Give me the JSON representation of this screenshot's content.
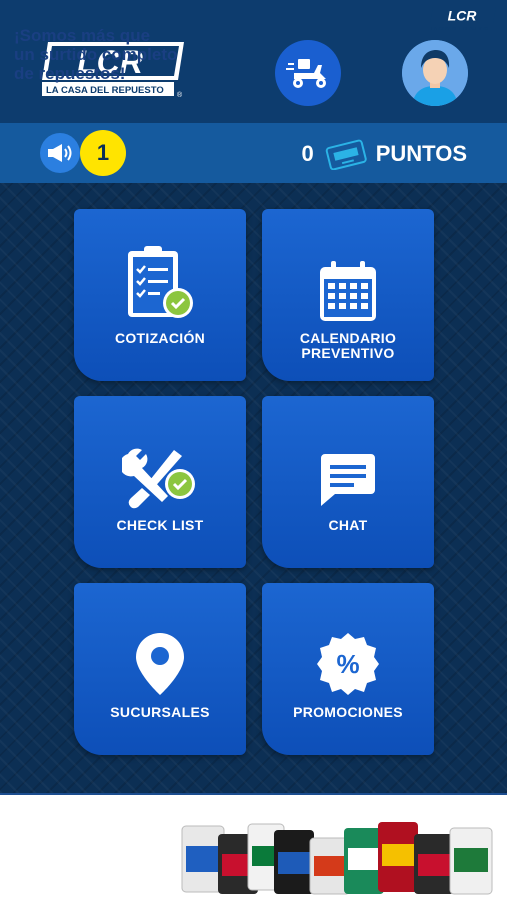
{
  "header": {
    "logo_text": "LCR",
    "logo_subtitle": "LA CASA DEL REPUESTO",
    "logo_mark": "®",
    "delivery_icon": "delivery-scooter-icon",
    "profile_icon": "user-avatar-icon"
  },
  "points_bar": {
    "announcement_icon": "megaphone-icon",
    "notification_count": "1",
    "points_value": "0",
    "points_label": "PUNTOS",
    "card_icon": "loyalty-card-icon"
  },
  "menu": {
    "tiles": [
      {
        "label": "COTIZACIÓN",
        "icon": "clipboard-check-icon"
      },
      {
        "label": "CALENDARIO\nPREVENTIVO",
        "icon": "calendar-icon"
      },
      {
        "label": "CHECK LIST",
        "icon": "tools-check-icon"
      },
      {
        "label": "CHAT",
        "icon": "chat-bubble-icon"
      },
      {
        "label": "SUCURSALES",
        "icon": "map-pin-icon"
      },
      {
        "label": "PROMOCIONES",
        "icon": "percent-badge-icon"
      }
    ]
  },
  "banner": {
    "text": "¡Somos más que\nun surtido completo\nde repuestos!",
    "logo_text": "LCR",
    "logo_subtitle": "LA CASA DEL REPUESTO"
  },
  "colors": {
    "header_bg": "#0d3c6e",
    "points_bar_bg": "#155a9e",
    "tile_blue": "#1c66d1",
    "badge_yellow": "#ffe400",
    "check_green": "#8cc63f",
    "banner_text": "#1a3f82"
  }
}
